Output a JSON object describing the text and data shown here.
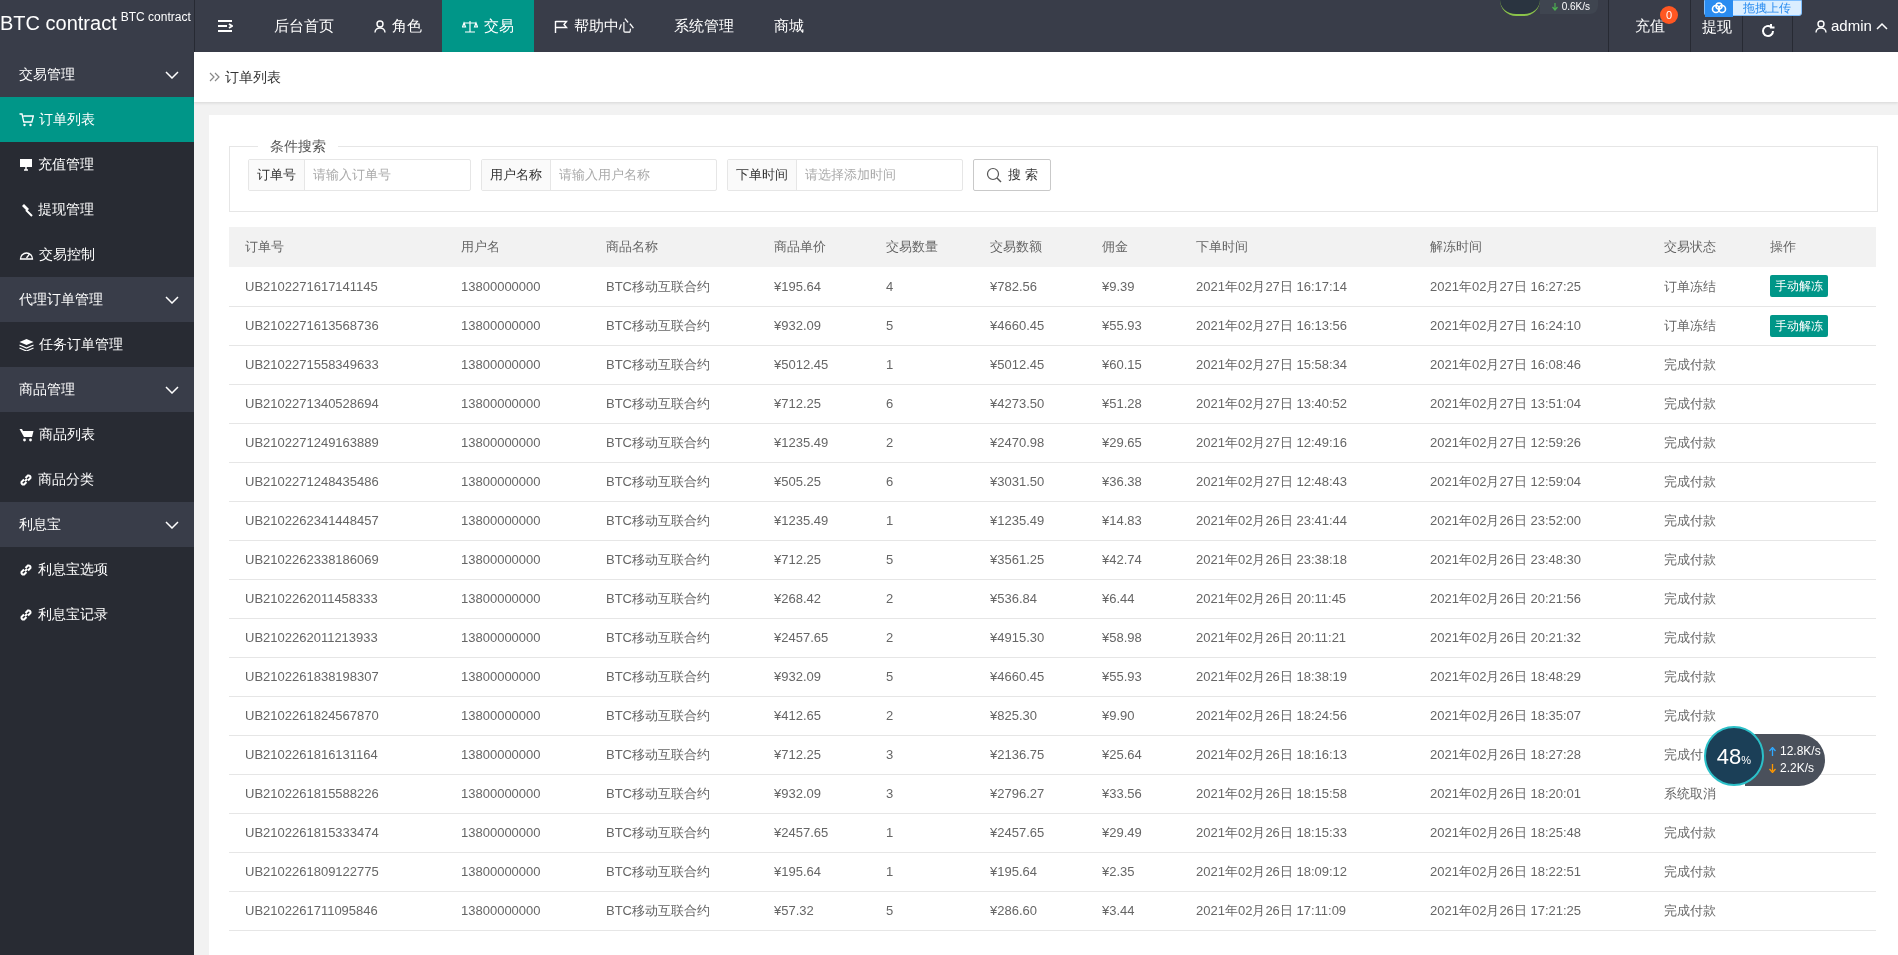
{
  "logo": {
    "title": "BTC contract",
    "subtitle": "BTC contract"
  },
  "nav": [
    {
      "label": "后台首页",
      "selected": false
    },
    {
      "label": "角色",
      "selected": false
    },
    {
      "label": "交易",
      "selected": true
    },
    {
      "label": "帮助中心",
      "selected": false
    },
    {
      "label": "系统管理",
      "selected": false
    },
    {
      "label": "商城",
      "selected": false
    }
  ],
  "top_right": {
    "recharge": {
      "label": "充值",
      "badge": "0"
    },
    "withdraw": {
      "label": "提现"
    },
    "user": "admin"
  },
  "sidebar": [
    {
      "label": "交易管理",
      "expanded": true,
      "children": [
        {
          "label": "订单列表",
          "selected": true
        },
        {
          "label": "充值管理",
          "selected": false
        },
        {
          "label": "提现管理",
          "selected": false
        },
        {
          "label": "交易控制",
          "selected": false
        }
      ]
    },
    {
      "label": "代理订单管理",
      "expanded": true,
      "children": [
        {
          "label": "任务订单管理",
          "selected": false
        }
      ]
    },
    {
      "label": "商品管理",
      "expanded": true,
      "children": [
        {
          "label": "商品列表",
          "selected": false
        },
        {
          "label": "商品分类",
          "selected": false
        }
      ]
    },
    {
      "label": "利息宝",
      "expanded": true,
      "children": [
        {
          "label": "利息宝选项",
          "selected": false
        },
        {
          "label": "利息宝记录",
          "selected": false
        }
      ]
    }
  ],
  "breadcrumb": "订单列表",
  "search": {
    "legend": "条件搜索",
    "fields": [
      {
        "label": "订单号",
        "placeholder": "请输入订单号"
      },
      {
        "label": "用户名称",
        "placeholder": "请输入用户名称"
      },
      {
        "label": "下单时间",
        "placeholder": "请选择添加时间"
      }
    ],
    "button": "搜 索"
  },
  "table": {
    "columns": [
      "订单号",
      "用户名",
      "商品名称",
      "商品单价",
      "交易数量",
      "交易数额",
      "佣金",
      "下单时间",
      "解冻时间",
      "交易状态",
      "操作"
    ],
    "rows": [
      {
        "cells": [
          "UB2102271617141145",
          "13800000000",
          "BTC移动互联合约",
          "¥195.64",
          "4",
          "¥782.56",
          "¥9.39",
          "2021年02月27日 16:17:14",
          "2021年02月27日 16:27:25",
          "订单冻结"
        ],
        "action": "手动解冻"
      },
      {
        "cells": [
          "UB2102271613568736",
          "13800000000",
          "BTC移动互联合约",
          "¥932.09",
          "5",
          "¥4660.45",
          "¥55.93",
          "2021年02月27日 16:13:56",
          "2021年02月27日 16:24:10",
          "订单冻结"
        ],
        "action": "手动解冻"
      },
      {
        "cells": [
          "UB2102271558349633",
          "13800000000",
          "BTC移动互联合约",
          "¥5012.45",
          "1",
          "¥5012.45",
          "¥60.15",
          "2021年02月27日 15:58:34",
          "2021年02月27日 16:08:46",
          "完成付款"
        ]
      },
      {
        "cells": [
          "UB2102271340528694",
          "13800000000",
          "BTC移动互联合约",
          "¥712.25",
          "6",
          "¥4273.50",
          "¥51.28",
          "2021年02月27日 13:40:52",
          "2021年02月27日 13:51:04",
          "完成付款"
        ]
      },
      {
        "cells": [
          "UB2102271249163889",
          "13800000000",
          "BTC移动互联合约",
          "¥1235.49",
          "2",
          "¥2470.98",
          "¥29.65",
          "2021年02月27日 12:49:16",
          "2021年02月27日 12:59:26",
          "完成付款"
        ]
      },
      {
        "cells": [
          "UB2102271248435486",
          "13800000000",
          "BTC移动互联合约",
          "¥505.25",
          "6",
          "¥3031.50",
          "¥36.38",
          "2021年02月27日 12:48:43",
          "2021年02月27日 12:59:04",
          "完成付款"
        ]
      },
      {
        "cells": [
          "UB2102262341448457",
          "13800000000",
          "BTC移动互联合约",
          "¥1235.49",
          "1",
          "¥1235.49",
          "¥14.83",
          "2021年02月26日 23:41:44",
          "2021年02月26日 23:52:00",
          "完成付款"
        ]
      },
      {
        "cells": [
          "UB2102262338186069",
          "13800000000",
          "BTC移动互联合约",
          "¥712.25",
          "5",
          "¥3561.25",
          "¥42.74",
          "2021年02月26日 23:38:18",
          "2021年02月26日 23:48:30",
          "完成付款"
        ]
      },
      {
        "cells": [
          "UB2102262011458333",
          "13800000000",
          "BTC移动互联合约",
          "¥268.42",
          "2",
          "¥536.84",
          "¥6.44",
          "2021年02月26日 20:11:45",
          "2021年02月26日 20:21:56",
          "完成付款"
        ]
      },
      {
        "cells": [
          "UB2102262011213933",
          "13800000000",
          "BTC移动互联合约",
          "¥2457.65",
          "2",
          "¥4915.30",
          "¥58.98",
          "2021年02月26日 20:11:21",
          "2021年02月26日 20:21:32",
          "完成付款"
        ]
      },
      {
        "cells": [
          "UB2102261838198307",
          "13800000000",
          "BTC移动互联合约",
          "¥932.09",
          "5",
          "¥4660.45",
          "¥55.93",
          "2021年02月26日 18:38:19",
          "2021年02月26日 18:48:29",
          "完成付款"
        ]
      },
      {
        "cells": [
          "UB2102261824567870",
          "13800000000",
          "BTC移动互联合约",
          "¥412.65",
          "2",
          "¥825.30",
          "¥9.90",
          "2021年02月26日 18:24:56",
          "2021年02月26日 18:35:07",
          "完成付款"
        ]
      },
      {
        "cells": [
          "UB2102261816131164",
          "13800000000",
          "BTC移动互联合约",
          "¥712.25",
          "3",
          "¥2136.75",
          "¥25.64",
          "2021年02月26日 18:16:13",
          "2021年02月26日 18:27:28",
          "完成付"
        ]
      },
      {
        "cells": [
          "UB2102261815588226",
          "13800000000",
          "BTC移动互联合约",
          "¥932.09",
          "3",
          "¥2796.27",
          "¥33.56",
          "2021年02月26日 18:15:58",
          "2021年02月26日 18:20:01",
          "系统取消"
        ]
      },
      {
        "cells": [
          "UB2102261815333474",
          "13800000000",
          "BTC移动互联合约",
          "¥2457.65",
          "1",
          "¥2457.65",
          "¥29.49",
          "2021年02月26日 18:15:33",
          "2021年02月26日 18:25:48",
          "完成付款"
        ]
      },
      {
        "cells": [
          "UB2102261809122775",
          "13800000000",
          "BTC移动互联合约",
          "¥195.64",
          "1",
          "¥195.64",
          "¥2.35",
          "2021年02月26日 18:09:12",
          "2021年02月26日 18:22:51",
          "完成付款"
        ]
      },
      {
        "cells": [
          "UB2102261711095846",
          "13800000000",
          "BTC移动互联合约",
          "¥57.32",
          "5",
          "¥286.60",
          "¥3.44",
          "2021年02月26日 17:11:09",
          "2021年02月26日 17:21:25",
          "完成付款"
        ]
      }
    ]
  },
  "net_monitor": {
    "percent": "48",
    "unit": "%",
    "up": "12.8",
    "up_unit": "K/s",
    "down": "2.2",
    "down_unit": "K/s"
  },
  "top_monitor": {
    "down": "0.6",
    "rate_unit": "K/s"
  },
  "upload_button": "拖拽上传"
}
